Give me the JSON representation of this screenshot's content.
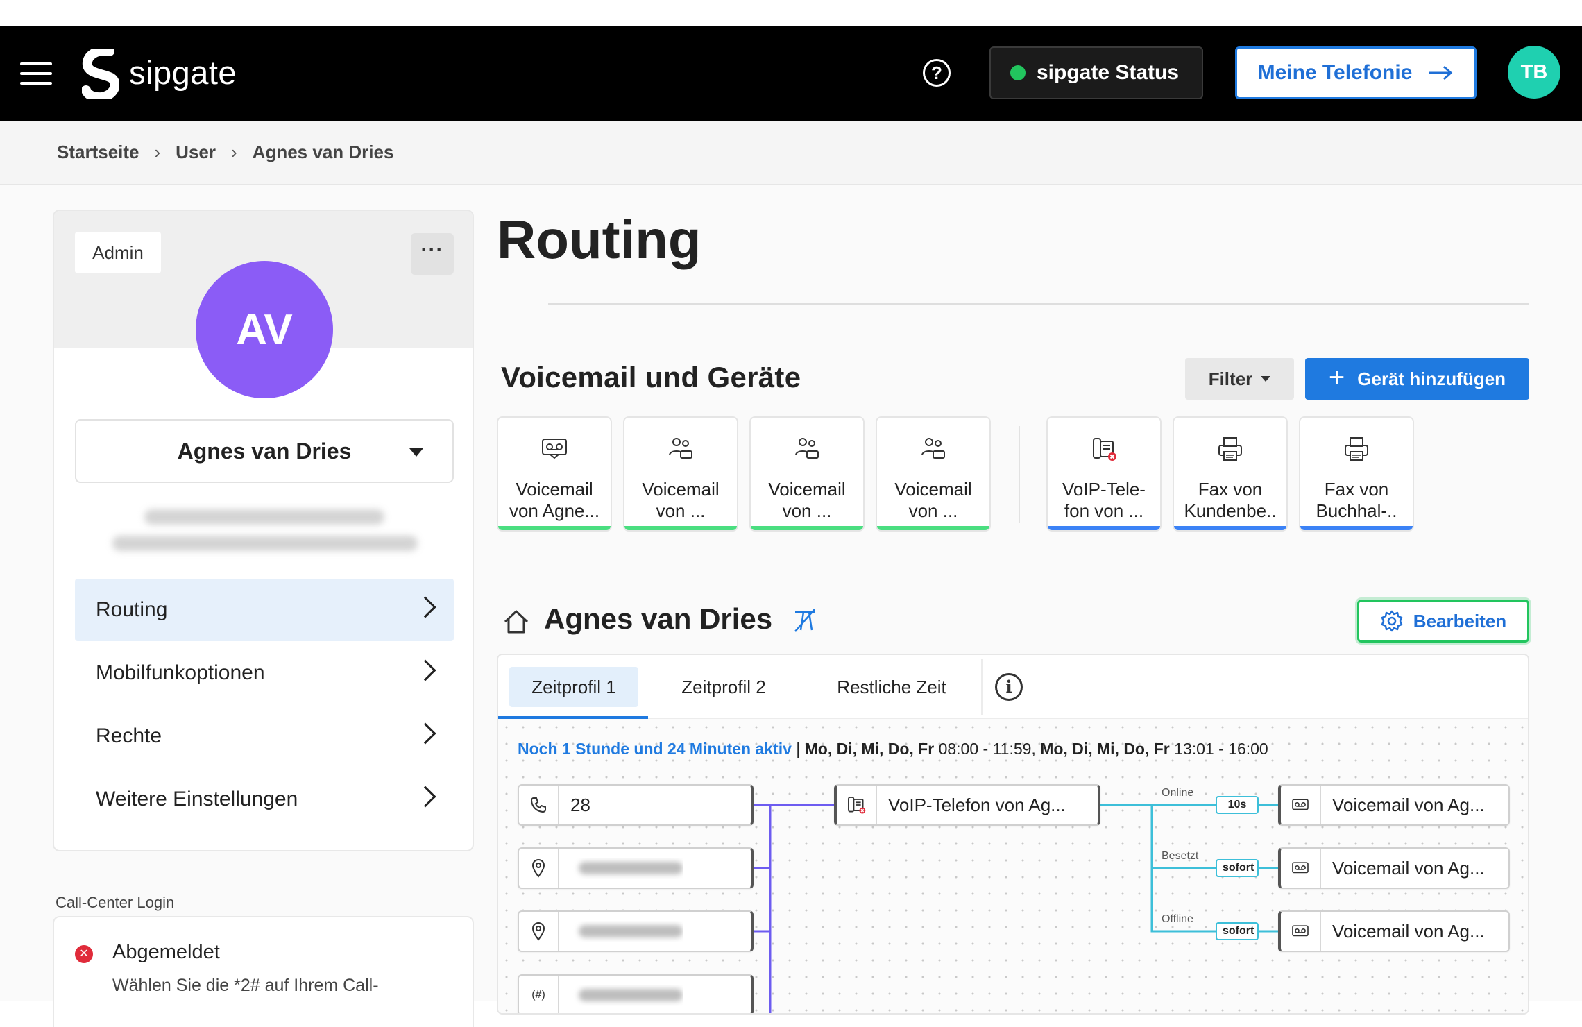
{
  "header": {
    "logo_text": "sipgate",
    "status_label": "sipgate Status",
    "my_phone_label": "Meine Telefonie",
    "user_initials": "TB",
    "colors": {
      "status": "#22c55e",
      "accent": "#1f7ae0",
      "avatar": "#1fd0b0"
    }
  },
  "breadcrumb": [
    "Startseite",
    "User",
    "Agnes van Dries"
  ],
  "profile": {
    "role_badge": "Admin",
    "initials": "AV",
    "name": "Agnes van Dries",
    "avatar_color": "#8b5cf6"
  },
  "nav": [
    {
      "label": "Routing",
      "active": true
    },
    {
      "label": "Mobilfunkoptionen",
      "active": false
    },
    {
      "label": "Rechte",
      "active": false
    },
    {
      "label": "Weitere Einstellungen",
      "active": false
    }
  ],
  "call_center": {
    "label": "Call-Center Login",
    "status": "Abgemeldet",
    "description": "Wählen Sie die *2# auf Ihrem Call-"
  },
  "main": {
    "title": "Routing",
    "section_title": "Voicemail und Geräte",
    "filter_label": "Filter",
    "add_device_label": "Gerät hinzufügen",
    "devices": [
      {
        "label_1": "Voicemail",
        "label_2": "von Agne...",
        "icon": "voicemail-icon",
        "bar_color": "#4ade80"
      },
      {
        "label_1": "Voicemail",
        "label_2": "von ...",
        "icon": "group-icon",
        "bar_color": "#4ade80"
      },
      {
        "label_1": "Voicemail",
        "label_2": "von ...",
        "icon": "group-icon",
        "bar_color": "#4ade80"
      },
      {
        "label_1": "Voicemail",
        "label_2": "von ...",
        "icon": "group-icon",
        "bar_color": "#4ade80"
      },
      {
        "label_1": "VoIP-Tele-",
        "label_2": "fon von ...",
        "icon": "voip-phone-icon",
        "bar_color": "#3b82f6"
      },
      {
        "label_1": "Fax von",
        "label_2": "Kundenbe..",
        "icon": "fax-icon",
        "bar_color": "#3b82f6"
      },
      {
        "label_1": "Fax von",
        "label_2": "Buchhal-..",
        "icon": "fax-icon",
        "bar_color": "#3b82f6"
      }
    ]
  },
  "routing": {
    "name": "Agnes van Dries",
    "edit_label": "Bearbeiten",
    "tabs": [
      "Zeitprofil 1",
      "Zeitprofil 2",
      "Restliche Zeit"
    ],
    "active_text": "Noch 1 Stunde und 24 Minuten aktiv",
    "days_1": "Mo, Di, Mi, Do, Fr",
    "time_1": "08:00 - 11:59,",
    "days_2": "Mo, Di, Mi, Do, Fr",
    "time_2": "13:01 - 16:00",
    "source_extension": "28",
    "device_node": "VoIP-Telefon von Ag...",
    "conditions": [
      {
        "label": "Online",
        "delay": "10s",
        "target": "Voicemail von Ag..."
      },
      {
        "label": "Besetzt",
        "delay": "sofort",
        "target": "Voicemail von Ag..."
      },
      {
        "label": "Offline",
        "delay": "sofort",
        "target": "Voicemail von Ag..."
      }
    ]
  }
}
